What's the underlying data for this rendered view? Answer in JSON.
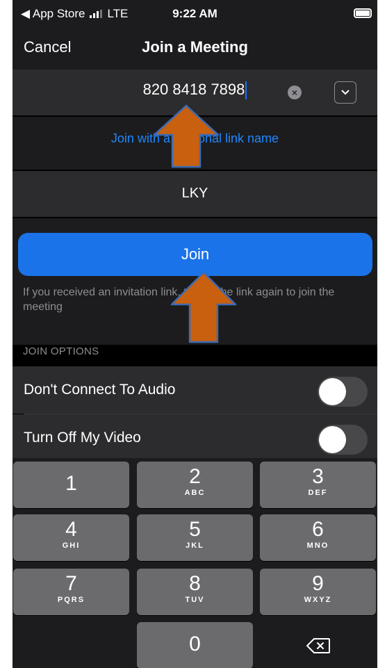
{
  "status_bar": {
    "back_label": "◀ App Store",
    "network": "LTE",
    "time": "9:22 AM"
  },
  "nav": {
    "cancel_label": "Cancel",
    "title": "Join a Meeting"
  },
  "meeting_id": {
    "value": "820 8418 7898"
  },
  "personal_link": {
    "label": "Join with a personal link name"
  },
  "display_name": {
    "value": "LKY"
  },
  "join_button": {
    "label": "Join"
  },
  "hint": "If you received an invitation link, tap on the link again to join the meeting",
  "options": {
    "header": "JOIN OPTIONS",
    "items": [
      {
        "label": "Don't Connect To Audio",
        "on": false
      },
      {
        "label": "Turn Off My Video",
        "on": false
      }
    ]
  },
  "keypad": {
    "keys": [
      {
        "num": "1",
        "letters": ""
      },
      {
        "num": "2",
        "letters": "ABC"
      },
      {
        "num": "3",
        "letters": "DEF"
      },
      {
        "num": "4",
        "letters": "GHI"
      },
      {
        "num": "5",
        "letters": "JKL"
      },
      {
        "num": "6",
        "letters": "MNO"
      },
      {
        "num": "7",
        "letters": "PQRS"
      },
      {
        "num": "8",
        "letters": "TUV"
      },
      {
        "num": "9",
        "letters": "WXYZ"
      },
      {
        "num": "0",
        "letters": ""
      }
    ]
  },
  "colors": {
    "accent_blue": "#1a73e8",
    "link_blue": "#1e88ff",
    "annotation_arrow": "#c8600f"
  }
}
